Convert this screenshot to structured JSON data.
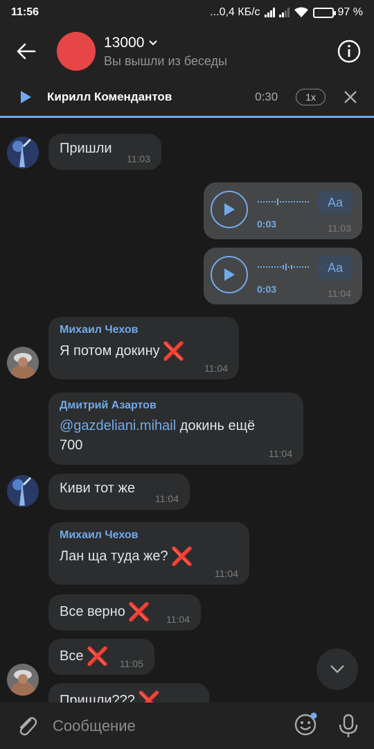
{
  "status_bar": {
    "time": "11:56",
    "network_speed": "...0,4 КБ/с",
    "battery": "97 %",
    "battery_level": 0.97
  },
  "header": {
    "title": "13000",
    "subtitle": "Вы вышли из беседы"
  },
  "player": {
    "author": "Кирилл Комендантов",
    "duration": "0:30",
    "speed": "1x"
  },
  "messages": [
    {
      "text": "Пришли",
      "time": "11:03",
      "direction": "in"
    },
    {
      "voice_duration": "0:03",
      "transcribe_label": "Aa",
      "time": "11:03",
      "direction": "out"
    },
    {
      "voice_duration": "0:03",
      "transcribe_label": "Aa",
      "time": "11:04",
      "direction": "out"
    },
    {
      "sender": "Михаил Чехов",
      "text": "Я потом докину",
      "emoji": "❌",
      "time": "11:04",
      "direction": "in"
    },
    {
      "sender": "Дмитрий Азартов",
      "mention": "@gazdeliani.mihail",
      "text": " докинь ещё 700",
      "time": "11:04",
      "direction": "in"
    },
    {
      "text": "Киви тот же",
      "time": "11:04",
      "direction": "in"
    },
    {
      "sender": "Михаил Чехов",
      "text": "Лан ща  туда же?",
      "emoji": "❌",
      "time": "11:04",
      "direction": "in"
    },
    {
      "text": "Все верно",
      "emoji": "❌",
      "time": "11:04",
      "direction": "in"
    },
    {
      "text": "Все",
      "emoji": "❌",
      "time": "11:05",
      "direction": "in"
    },
    {
      "text": "Пришли???",
      "emoji": "❌",
      "direction": "in"
    }
  ],
  "input": {
    "placeholder": "Сообщение"
  },
  "colors": {
    "background": "#1a1a1a",
    "bar": "#222222",
    "bubble_in": "#2c2d2e",
    "bubble_out": "#454647",
    "accent": "#71aaeb",
    "avatar_red": "#e64646"
  }
}
